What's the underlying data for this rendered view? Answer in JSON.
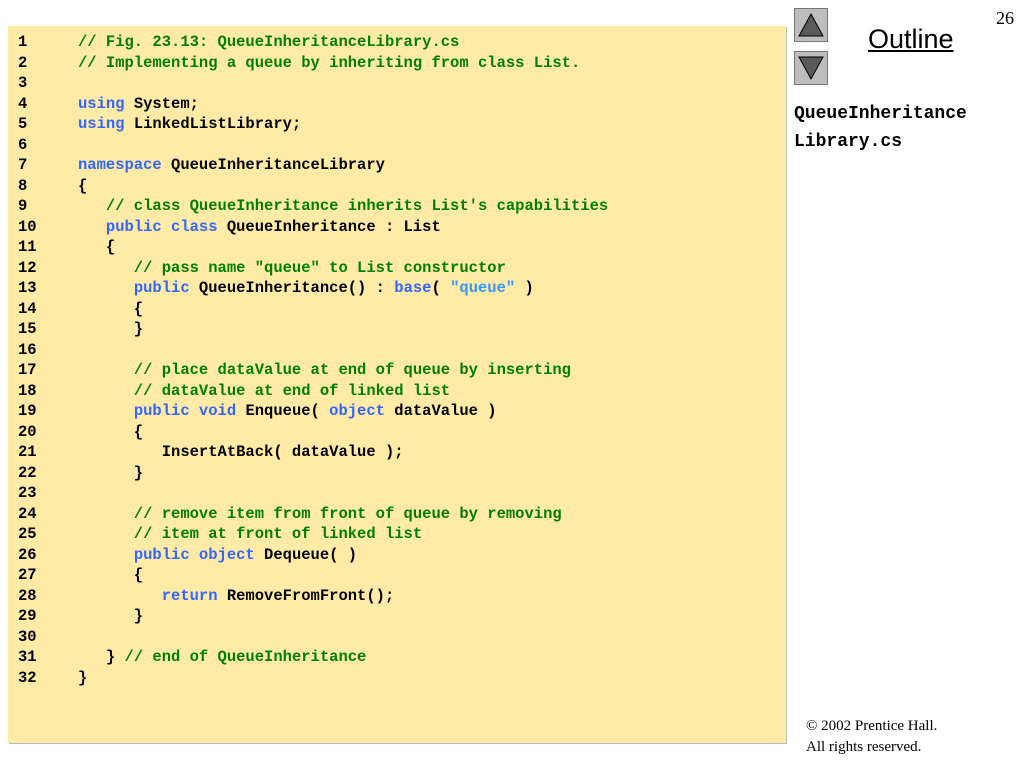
{
  "slide": {
    "number": "26"
  },
  "nav": {
    "outline_label": "Outline",
    "up_icon": "triangle-up-icon",
    "down_icon": "triangle-down-icon"
  },
  "file_title": {
    "line1": "QueueInheritance",
    "line2": "Library.cs"
  },
  "footer": {
    "copyright_symbol": "©",
    "copyright_line1": " 2002 Prentice Hall.",
    "copyright_line2": "All rights reserved."
  },
  "colors": {
    "panel_bg": "#ffeba6",
    "comment": "#008000",
    "keyword": "#3366ff",
    "string": "#3399ff"
  },
  "code_lines": [
    {
      "num": "1",
      "tokens": [
        {
          "t": "// Fig. 23.13: QueueInheritanceLibrary.cs",
          "k": "comment"
        }
      ]
    },
    {
      "num": "2",
      "tokens": [
        {
          "t": "// Implementing a queue by inheriting from class List.",
          "k": "comment"
        }
      ]
    },
    {
      "num": "3",
      "tokens": []
    },
    {
      "num": "4",
      "tokens": [
        {
          "t": "using",
          "k": "keyword"
        },
        {
          "t": " System;",
          "k": "plain"
        }
      ]
    },
    {
      "num": "5",
      "tokens": [
        {
          "t": "using",
          "k": "keyword"
        },
        {
          "t": " LinkedListLibrary;",
          "k": "plain"
        }
      ]
    },
    {
      "num": "6",
      "tokens": []
    },
    {
      "num": "7",
      "tokens": [
        {
          "t": "namespace",
          "k": "keyword"
        },
        {
          "t": " QueueInheritanceLibrary",
          "k": "plain"
        }
      ]
    },
    {
      "num": "8",
      "tokens": [
        {
          "t": "{",
          "k": "plain"
        }
      ]
    },
    {
      "num": "9",
      "tokens": [
        {
          "t": "   // class QueueInheritance inherits List's capabilities",
          "k": "comment"
        }
      ]
    },
    {
      "num": "10",
      "tokens": [
        {
          "t": "   ",
          "k": "plain"
        },
        {
          "t": "public class",
          "k": "keyword"
        },
        {
          "t": " QueueInheritance : List",
          "k": "plain"
        }
      ]
    },
    {
      "num": "11",
      "tokens": [
        {
          "t": "   {",
          "k": "plain"
        }
      ]
    },
    {
      "num": "12",
      "tokens": [
        {
          "t": "      // pass name \"queue\" to List constructor",
          "k": "comment"
        }
      ]
    },
    {
      "num": "13",
      "tokens": [
        {
          "t": "      ",
          "k": "plain"
        },
        {
          "t": "public",
          "k": "keyword"
        },
        {
          "t": " QueueInheritance() : ",
          "k": "plain"
        },
        {
          "t": "base",
          "k": "keyword"
        },
        {
          "t": "( ",
          "k": "plain"
        },
        {
          "t": "\"queue\"",
          "k": "string"
        },
        {
          "t": " )",
          "k": "plain"
        }
      ]
    },
    {
      "num": "14",
      "tokens": [
        {
          "t": "      {",
          "k": "plain"
        }
      ]
    },
    {
      "num": "15",
      "tokens": [
        {
          "t": "      }",
          "k": "plain"
        }
      ]
    },
    {
      "num": "16",
      "tokens": []
    },
    {
      "num": "17",
      "tokens": [
        {
          "t": "      // place dataValue at end of queue by inserting",
          "k": "comment"
        }
      ]
    },
    {
      "num": "18",
      "tokens": [
        {
          "t": "      // dataValue at end of linked list",
          "k": "comment"
        }
      ]
    },
    {
      "num": "19",
      "tokens": [
        {
          "t": "      ",
          "k": "plain"
        },
        {
          "t": "public void",
          "k": "keyword"
        },
        {
          "t": " Enqueue( ",
          "k": "plain"
        },
        {
          "t": "object",
          "k": "keyword"
        },
        {
          "t": " dataValue )",
          "k": "plain"
        }
      ]
    },
    {
      "num": "20",
      "tokens": [
        {
          "t": "      {",
          "k": "plain"
        }
      ]
    },
    {
      "num": "21",
      "tokens": [
        {
          "t": "         InsertAtBack( dataValue );",
          "k": "plain"
        }
      ]
    },
    {
      "num": "22",
      "tokens": [
        {
          "t": "      }",
          "k": "plain"
        }
      ]
    },
    {
      "num": "23",
      "tokens": []
    },
    {
      "num": "24",
      "tokens": [
        {
          "t": "      // remove item from front of queue by removing",
          "k": "comment"
        }
      ]
    },
    {
      "num": "25",
      "tokens": [
        {
          "t": "      // item at front of linked list",
          "k": "comment"
        }
      ]
    },
    {
      "num": "26",
      "tokens": [
        {
          "t": "      ",
          "k": "plain"
        },
        {
          "t": "public object",
          "k": "keyword"
        },
        {
          "t": " Dequeue( )",
          "k": "plain"
        }
      ]
    },
    {
      "num": "27",
      "tokens": [
        {
          "t": "      {",
          "k": "plain"
        }
      ]
    },
    {
      "num": "28",
      "tokens": [
        {
          "t": "         ",
          "k": "plain"
        },
        {
          "t": "return",
          "k": "keyword"
        },
        {
          "t": " RemoveFromFront();",
          "k": "plain"
        }
      ]
    },
    {
      "num": "29",
      "tokens": [
        {
          "t": "      }",
          "k": "plain"
        }
      ]
    },
    {
      "num": "30",
      "tokens": []
    },
    {
      "num": "31",
      "tokens": [
        {
          "t": "   } ",
          "k": "plain"
        },
        {
          "t": "// end of QueueInheritance",
          "k": "comment"
        }
      ]
    },
    {
      "num": "32",
      "tokens": [
        {
          "t": "}",
          "k": "plain"
        }
      ]
    }
  ]
}
